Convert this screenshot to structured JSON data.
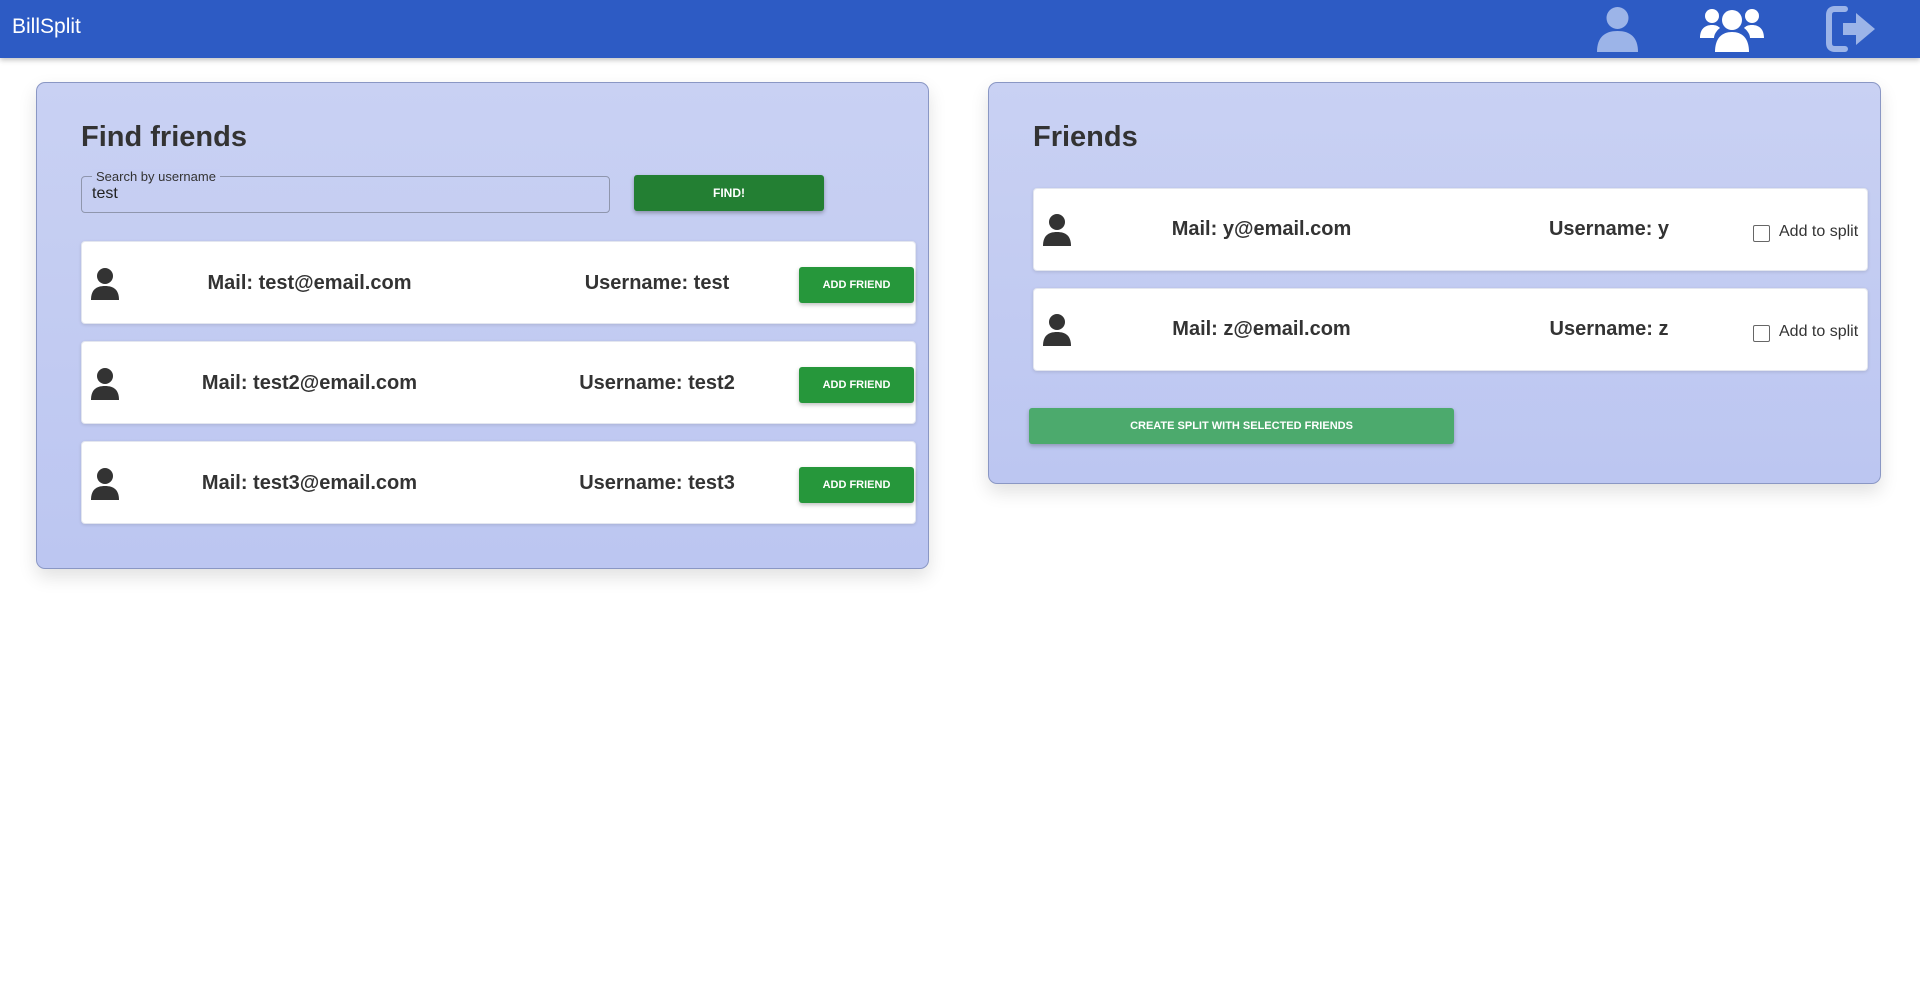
{
  "app": {
    "title": "BillSplit"
  },
  "nav": {
    "profile_icon": "user-icon",
    "friends_icon": "users-icon",
    "logout_icon": "sign-out-icon"
  },
  "colors": {
    "topbar": "#2d5bc4",
    "panel": "#c6cef3",
    "find_button": "#237f33",
    "add_button": "#26973b",
    "create_button": "#4caa6d"
  },
  "find_friends": {
    "title": "Find friends",
    "search": {
      "legend": "Search by username",
      "value": "test"
    },
    "find_label": "FIND!",
    "results": [
      {
        "mail": "Mail: test@email.com",
        "username": "Username: test",
        "action": "ADD FRIEND"
      },
      {
        "mail": "Mail: test2@email.com",
        "username": "Username: test2",
        "action": "ADD FRIEND"
      },
      {
        "mail": "Mail: test3@email.com",
        "username": "Username: test3",
        "action": "ADD FRIEND"
      }
    ]
  },
  "friends": {
    "title": "Friends",
    "list": [
      {
        "mail": "Mail: y@email.com",
        "username": "Username: y",
        "checkbox_label": "Add to split",
        "checked": false
      },
      {
        "mail": "Mail: z@email.com",
        "username": "Username: z",
        "checkbox_label": "Add to split",
        "checked": false
      }
    ],
    "create_label": "CREATE SPLIT WITH SELECTED FRIENDS"
  }
}
